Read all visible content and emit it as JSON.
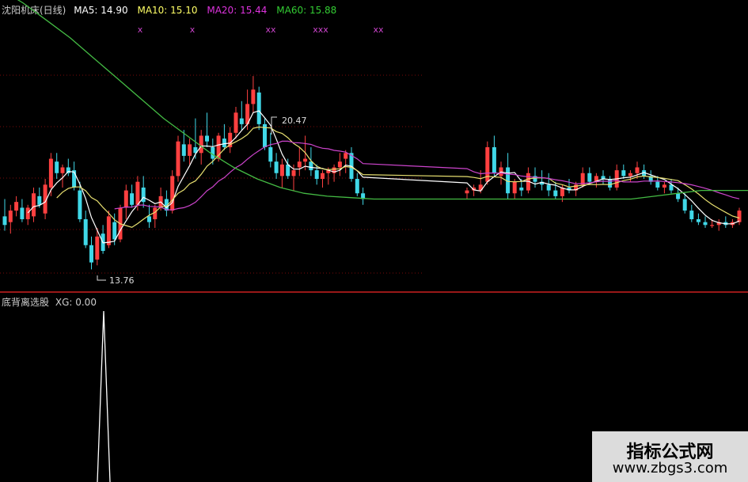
{
  "header": {
    "title": "沈阳机床(日线)",
    "ma5": {
      "label": "MA5:",
      "value": "14.90",
      "color": "#ffffff"
    },
    "ma10": {
      "label": "MA10:",
      "value": "15.10",
      "color": "#ffff66"
    },
    "ma20": {
      "label": "MA20:",
      "value": "15.44",
      "color": "#dd33dd"
    },
    "ma60": {
      "label": "MA60:",
      "value": "15.88",
      "color": "#33cc33"
    }
  },
  "indicator": {
    "title": "底背离选股",
    "xg_label": "XG:",
    "xg_value": "0.00"
  },
  "watermark": {
    "title": "指标公式网",
    "url": "www.zbgs3.com"
  },
  "colors": {
    "up": "#ff4040",
    "down": "#40d8e8",
    "ma5": "#ffffff",
    "ma10": "#e8e070",
    "ma20": "#cc44cc",
    "ma60": "#44bb44",
    "grid": "#7a0a0a",
    "divider": "#cc2020"
  },
  "chart_data": {
    "type": "candlestick",
    "annotations": {
      "high_label": "20.47",
      "low_label": "13.76"
    },
    "candles": [
      {
        "o": 15.6,
        "h": 16.2,
        "l": 15.1,
        "c": 15.3
      },
      {
        "o": 15.4,
        "h": 16.0,
        "l": 15.0,
        "c": 15.8
      },
      {
        "o": 15.8,
        "h": 16.3,
        "l": 15.6,
        "c": 16.1
      },
      {
        "o": 15.9,
        "h": 16.2,
        "l": 15.4,
        "c": 15.5
      },
      {
        "o": 15.5,
        "h": 16.0,
        "l": 15.3,
        "c": 15.9
      },
      {
        "o": 15.6,
        "h": 16.6,
        "l": 15.4,
        "c": 16.4
      },
      {
        "o": 16.3,
        "h": 16.6,
        "l": 15.9,
        "c": 16.0
      },
      {
        "o": 15.7,
        "h": 16.9,
        "l": 15.5,
        "c": 16.7
      },
      {
        "o": 16.6,
        "h": 17.8,
        "l": 16.3,
        "c": 17.6
      },
      {
        "o": 17.5,
        "h": 17.8,
        "l": 16.9,
        "c": 17.1
      },
      {
        "o": 17.1,
        "h": 17.4,
        "l": 16.6,
        "c": 17.3
      },
      {
        "o": 17.3,
        "h": 17.6,
        "l": 17.0,
        "c": 17.1
      },
      {
        "o": 17.2,
        "h": 17.5,
        "l": 16.5,
        "c": 16.6
      },
      {
        "o": 16.5,
        "h": 16.8,
        "l": 15.4,
        "c": 15.5
      },
      {
        "o": 15.5,
        "h": 15.8,
        "l": 14.5,
        "c": 14.6
      },
      {
        "o": 14.6,
        "h": 14.9,
        "l": 13.76,
        "c": 14.0
      },
      {
        "o": 14.1,
        "h": 15.2,
        "l": 13.9,
        "c": 14.9
      },
      {
        "o": 15.0,
        "h": 15.3,
        "l": 14.3,
        "c": 14.4
      },
      {
        "o": 14.6,
        "h": 15.8,
        "l": 14.5,
        "c": 15.6
      },
      {
        "o": 15.4,
        "h": 15.7,
        "l": 14.6,
        "c": 14.8
      },
      {
        "o": 14.8,
        "h": 16.0,
        "l": 14.7,
        "c": 15.9
      },
      {
        "o": 15.9,
        "h": 16.7,
        "l": 15.5,
        "c": 16.5
      },
      {
        "o": 16.4,
        "h": 16.7,
        "l": 15.9,
        "c": 16.0
      },
      {
        "o": 16.0,
        "h": 17.0,
        "l": 15.8,
        "c": 16.8
      },
      {
        "o": 16.6,
        "h": 17.0,
        "l": 15.9,
        "c": 16.1
      },
      {
        "o": 15.6,
        "h": 16.0,
        "l": 15.2,
        "c": 15.4
      },
      {
        "o": 15.5,
        "h": 16.0,
        "l": 15.2,
        "c": 15.9
      },
      {
        "o": 15.9,
        "h": 16.6,
        "l": 15.8,
        "c": 16.3
      },
      {
        "o": 16.2,
        "h": 16.5,
        "l": 15.6,
        "c": 15.8
      },
      {
        "o": 15.8,
        "h": 17.2,
        "l": 15.7,
        "c": 17.0
      },
      {
        "o": 17.0,
        "h": 18.4,
        "l": 16.8,
        "c": 18.2
      },
      {
        "o": 18.1,
        "h": 18.6,
        "l": 17.5,
        "c": 17.7
      },
      {
        "o": 17.7,
        "h": 18.3,
        "l": 17.4,
        "c": 18.1
      },
      {
        "o": 18.0,
        "h": 19.0,
        "l": 17.6,
        "c": 17.8
      },
      {
        "o": 17.8,
        "h": 18.6,
        "l": 17.4,
        "c": 18.4
      },
      {
        "o": 18.4,
        "h": 19.2,
        "l": 18.0,
        "c": 18.2
      },
      {
        "o": 18.0,
        "h": 18.3,
        "l": 17.4,
        "c": 17.6
      },
      {
        "o": 17.6,
        "h": 18.5,
        "l": 17.5,
        "c": 18.4
      },
      {
        "o": 18.3,
        "h": 18.8,
        "l": 17.9,
        "c": 18.0
      },
      {
        "o": 18.0,
        "h": 18.7,
        "l": 17.8,
        "c": 18.5
      },
      {
        "o": 18.5,
        "h": 19.4,
        "l": 18.3,
        "c": 19.2
      },
      {
        "o": 19.0,
        "h": 19.6,
        "l": 18.6,
        "c": 18.8
      },
      {
        "o": 18.8,
        "h": 20.0,
        "l": 18.6,
        "c": 19.5
      },
      {
        "o": 19.5,
        "h": 20.47,
        "l": 19.2,
        "c": 20.0
      },
      {
        "o": 19.9,
        "h": 20.1,
        "l": 18.6,
        "c": 18.8
      },
      {
        "o": 18.8,
        "h": 19.0,
        "l": 17.9,
        "c": 18.0
      },
      {
        "o": 18.0,
        "h": 18.5,
        "l": 17.3,
        "c": 17.5
      },
      {
        "o": 17.5,
        "h": 17.8,
        "l": 16.9,
        "c": 17.1
      },
      {
        "o": 17.0,
        "h": 17.6,
        "l": 16.6,
        "c": 17.4
      },
      {
        "o": 17.4,
        "h": 17.6,
        "l": 16.9,
        "c": 17.0
      },
      {
        "o": 17.0,
        "h": 17.4,
        "l": 16.5,
        "c": 17.2
      },
      {
        "o": 17.3,
        "h": 18.0,
        "l": 17.0,
        "c": 17.5
      },
      {
        "o": 17.5,
        "h": 18.4,
        "l": 17.2,
        "c": 17.6
      },
      {
        "o": 17.5,
        "h": 18.0,
        "l": 17.0,
        "c": 17.2
      },
      {
        "o": 17.2,
        "h": 17.4,
        "l": 16.7,
        "c": 16.9
      },
      {
        "o": 16.9,
        "h": 17.2,
        "l": 16.6,
        "c": 17.1
      },
      {
        "o": 17.1,
        "h": 17.3,
        "l": 16.7,
        "c": 17.2
      },
      {
        "o": 17.1,
        "h": 17.4,
        "l": 16.8,
        "c": 17.3
      },
      {
        "o": 17.3,
        "h": 17.8,
        "l": 17.0,
        "c": 17.5
      },
      {
        "o": 17.6,
        "h": 17.9,
        "l": 17.1,
        "c": 17.8
      },
      {
        "o": 17.8,
        "h": 18.0,
        "l": 16.8,
        "c": 16.9
      },
      {
        "o": 16.9,
        "h": 17.1,
        "l": 16.3,
        "c": 16.4
      },
      {
        "o": 16.4,
        "h": 16.6,
        "l": 16.0,
        "c": 16.2
      }
    ],
    "candles2": [
      {
        "o": 16.4,
        "h": 16.6,
        "l": 16.2,
        "c": 16.5
      },
      {
        "o": 16.5,
        "h": 16.7,
        "l": 16.3,
        "c": 16.6
      },
      {
        "o": 16.5,
        "h": 17.2,
        "l": 16.4,
        "c": 16.7
      },
      {
        "o": 16.8,
        "h": 18.2,
        "l": 16.7,
        "c": 18.0
      },
      {
        "o": 18.0,
        "h": 18.4,
        "l": 17.0,
        "c": 17.1
      },
      {
        "o": 17.0,
        "h": 17.5,
        "l": 16.7,
        "c": 17.3
      },
      {
        "o": 17.3,
        "h": 17.8,
        "l": 16.2,
        "c": 16.4
      },
      {
        "o": 16.4,
        "h": 16.9,
        "l": 16.2,
        "c": 16.8
      },
      {
        "o": 16.6,
        "h": 16.9,
        "l": 16.3,
        "c": 16.5
      },
      {
        "o": 16.5,
        "h": 17.3,
        "l": 16.4,
        "c": 17.1
      },
      {
        "o": 17.0,
        "h": 17.3,
        "l": 16.6,
        "c": 16.8
      },
      {
        "o": 16.8,
        "h": 17.2,
        "l": 16.5,
        "c": 16.7
      },
      {
        "o": 16.7,
        "h": 17.1,
        "l": 16.3,
        "c": 16.5
      },
      {
        "o": 16.5,
        "h": 16.8,
        "l": 16.2,
        "c": 16.3
      },
      {
        "o": 16.3,
        "h": 16.7,
        "l": 16.1,
        "c": 16.6
      },
      {
        "o": 16.6,
        "h": 16.9,
        "l": 16.4,
        "c": 16.5
      },
      {
        "o": 16.5,
        "h": 16.8,
        "l": 16.3,
        "c": 16.7
      },
      {
        "o": 16.7,
        "h": 17.3,
        "l": 16.6,
        "c": 17.1
      },
      {
        "o": 17.1,
        "h": 17.3,
        "l": 16.7,
        "c": 16.8
      },
      {
        "o": 16.8,
        "h": 17.1,
        "l": 16.6,
        "c": 17.0
      },
      {
        "o": 17.0,
        "h": 17.2,
        "l": 16.7,
        "c": 16.9
      },
      {
        "o": 16.9,
        "h": 17.0,
        "l": 16.5,
        "c": 16.6
      },
      {
        "o": 16.6,
        "h": 17.4,
        "l": 16.5,
        "c": 17.2
      },
      {
        "o": 17.2,
        "h": 17.4,
        "l": 16.9,
        "c": 17.0
      },
      {
        "o": 17.0,
        "h": 17.2,
        "l": 16.8,
        "c": 17.1
      },
      {
        "o": 17.1,
        "h": 17.5,
        "l": 16.9,
        "c": 17.3
      },
      {
        "o": 17.2,
        "h": 17.4,
        "l": 16.9,
        "c": 17.0
      },
      {
        "o": 17.0,
        "h": 17.2,
        "l": 16.7,
        "c": 16.8
      },
      {
        "o": 16.8,
        "h": 17.0,
        "l": 16.5,
        "c": 16.6
      },
      {
        "o": 16.6,
        "h": 16.8,
        "l": 16.4,
        "c": 16.7
      },
      {
        "o": 16.7,
        "h": 16.9,
        "l": 16.4,
        "c": 16.5
      },
      {
        "o": 16.4,
        "h": 16.6,
        "l": 16.1,
        "c": 16.2
      },
      {
        "o": 16.2,
        "h": 16.4,
        "l": 15.7,
        "c": 15.8
      },
      {
        "o": 15.8,
        "h": 16.0,
        "l": 15.4,
        "c": 15.5
      },
      {
        "o": 15.5,
        "h": 15.7,
        "l": 15.3,
        "c": 15.4
      },
      {
        "o": 15.4,
        "h": 15.6,
        "l": 15.2,
        "c": 15.3
      },
      {
        "o": 15.3,
        "h": 15.5,
        "l": 15.2,
        "c": 15.3
      },
      {
        "o": 15.3,
        "h": 15.5,
        "l": 15.1,
        "c": 15.4
      },
      {
        "o": 15.4,
        "h": 15.6,
        "l": 15.2,
        "c": 15.3
      },
      {
        "o": 15.3,
        "h": 15.5,
        "l": 15.2,
        "c": 15.4
      },
      {
        "o": 15.4,
        "h": 15.9,
        "l": 15.3,
        "c": 15.8
      }
    ],
    "ma60": [
      23.5,
      23.0,
      22.4,
      21.8,
      21.1,
      20.4,
      19.7,
      19.0,
      18.4,
      17.8,
      17.3,
      16.9,
      16.6,
      16.4,
      16.3,
      16.25,
      16.2,
      16.2,
      16.2,
      16.2,
      16.2,
      16.2,
      16.2,
      16.2,
      16.2,
      16.2,
      16.2,
      16.2,
      16.3,
      16.4,
      16.5,
      16.5,
      16.5
    ],
    "xg": {
      "label": "XG",
      "spike_value": 1.0,
      "baseline": 0.0
    },
    "signal_marks": [
      "x",
      "x",
      "xx",
      "xxx",
      "xx"
    ]
  }
}
